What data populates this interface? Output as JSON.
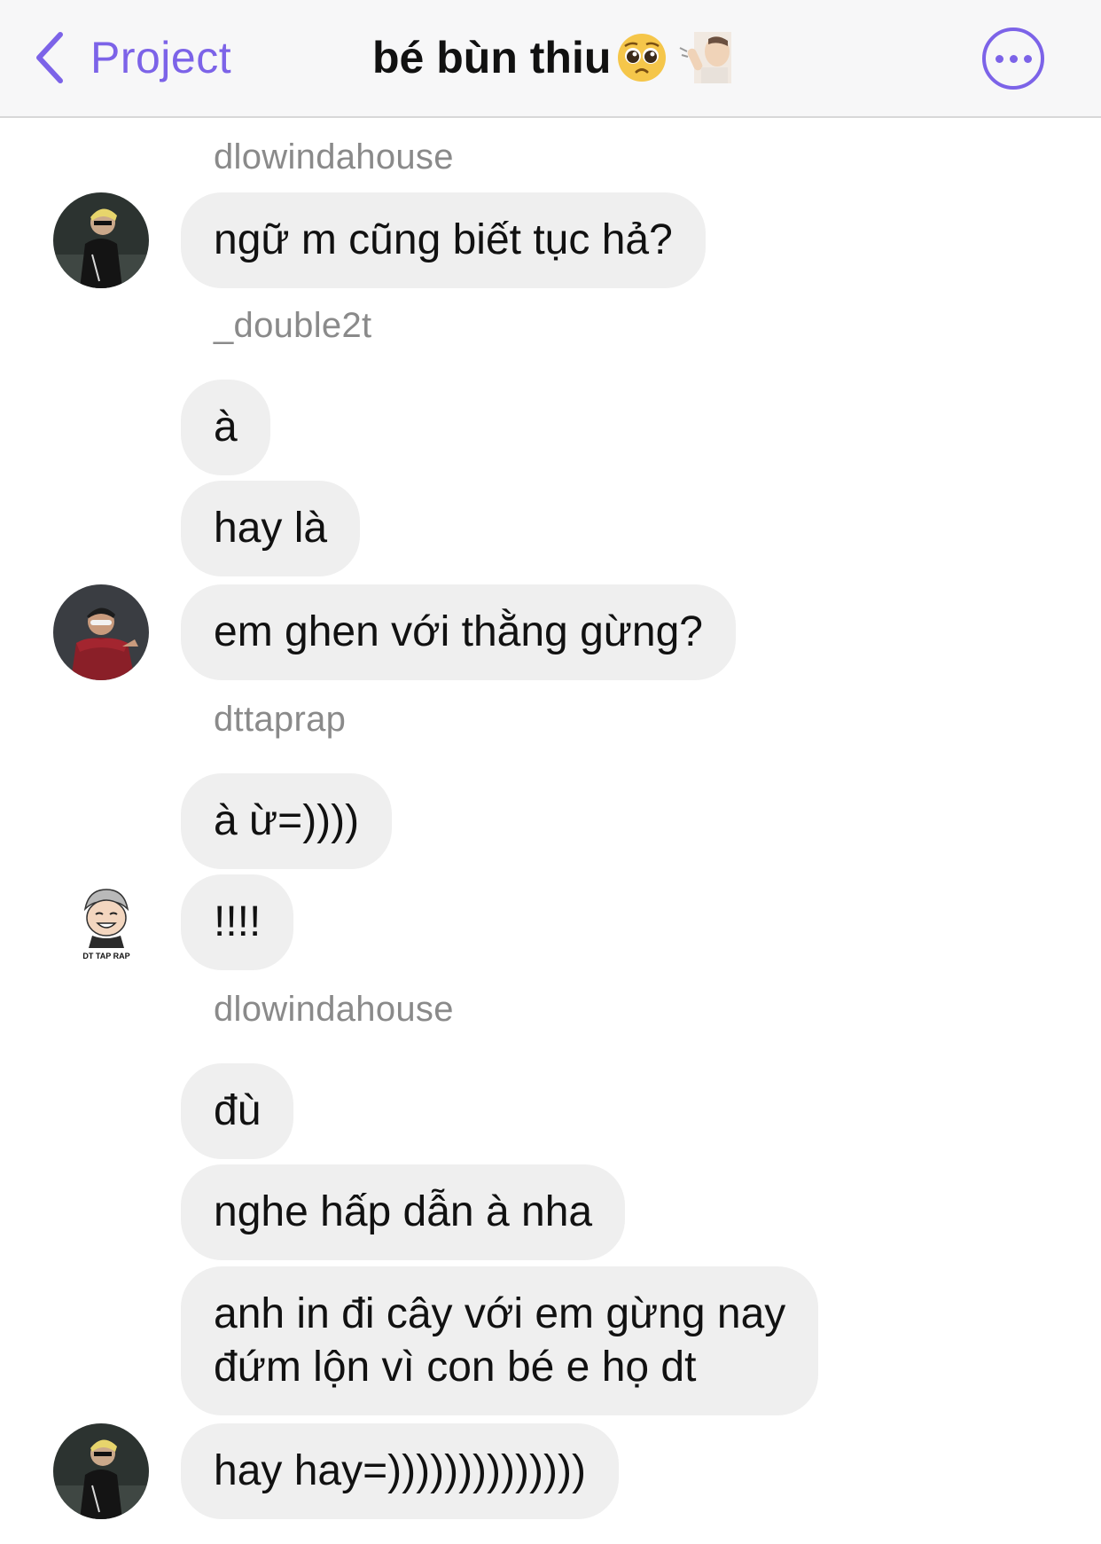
{
  "nav": {
    "back_label": "Project",
    "title": "bé bùn thiu",
    "title_emoji_1": "pleading-face",
    "title_emoji_2": "shushing-hand",
    "accent_color": "#7c63e8"
  },
  "messages": [
    {
      "username": "dlowindahouse",
      "text": "ngữ m cũng biết tục hả?"
    },
    {
      "username": "_double2t",
      "text": "à"
    },
    {
      "text": "hay là"
    },
    {
      "text": "em ghen với thằng gừng?"
    },
    {
      "username": "dttaprap",
      "text": "à ừ=))))"
    },
    {
      "text": "!!!!",
      "avatar_caption": "DT TAP RAP"
    },
    {
      "username": "dlowindahouse",
      "text": "đù"
    },
    {
      "text": "nghe hấp dẫn à nha"
    },
    {
      "text_line1": "anh in đi cây với em gừng nay",
      "text_line2": "đứm lộn vì con bé e họ dt"
    },
    {
      "text": "hay hay=))))))))))))))"
    }
  ]
}
